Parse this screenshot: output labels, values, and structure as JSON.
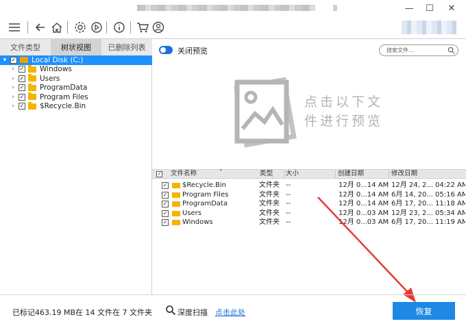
{
  "window": {
    "minimize_glyph": "—",
    "maximize_glyph": "☐",
    "close_glyph": "✕"
  },
  "toolbar": {
    "icons": [
      "menu-icon",
      "back-icon",
      "home-icon",
      "settings-icon",
      "play-icon",
      "info-icon",
      "cart-icon",
      "user-icon"
    ]
  },
  "tabs": [
    {
      "label": "文件类型",
      "active": false
    },
    {
      "label": "树状视图",
      "active": true
    },
    {
      "label": "已删除列表",
      "active": false
    }
  ],
  "tree": {
    "root": {
      "label": "Local Disk (C:)",
      "checked": true,
      "expanded": true,
      "selected": true
    },
    "children": [
      {
        "label": "Windows",
        "checked": true
      },
      {
        "label": "Users",
        "checked": true
      },
      {
        "label": "ProgramData",
        "checked": true
      },
      {
        "label": "Program Files",
        "checked": true
      },
      {
        "label": "$Recycle.Bin",
        "checked": true
      }
    ]
  },
  "preview": {
    "toggle_label": "关闭预览",
    "toggle_on": true,
    "hint_line1": "点击以下文",
    "hint_line2": "件进行预览"
  },
  "search": {
    "placeholder": "搜索文件..."
  },
  "table": {
    "select_all_checked": true,
    "columns": [
      "文件名称",
      "类型",
      "大小",
      "创建日期",
      "修改日期"
    ],
    "sort_glyph": "˄",
    "rows": [
      {
        "name": "$Recycle.Bin",
        "type": "文件夹",
        "size": "--",
        "created": "12月 0...14 AM",
        "modified": "12月 24, 2... 04:22 AM",
        "checked": true
      },
      {
        "name": "Program Files",
        "type": "文件夹",
        "size": "--",
        "created": "12月 0...14 AM",
        "modified": "6月 14, 20... 05:16 AM",
        "checked": true
      },
      {
        "name": "ProgramData",
        "type": "文件夹",
        "size": "--",
        "created": "12月 0...14 AM",
        "modified": "6月 17, 20... 11:18 AM",
        "checked": true
      },
      {
        "name": "Users",
        "type": "文件夹",
        "size": "--",
        "created": "12月 0...03 AM",
        "modified": "12月 23, 2... 05:34 AM",
        "checked": true
      },
      {
        "name": "Windows",
        "type": "文件夹",
        "size": "--",
        "created": "12月 0...03 AM",
        "modified": "6月 17, 20... 11:19 AM",
        "checked": true
      }
    ]
  },
  "footer": {
    "status": "已标记463.19 MB在 14 文件在 7 文件夹",
    "deep_scan_label": "深度扫描",
    "deep_scan_link": "点击此处",
    "recover_label": "恢复"
  },
  "colors": {
    "accent": "#1e88e5",
    "selection": "#1e90ff",
    "folder": "#f4b400",
    "arrow": "#e53935"
  }
}
